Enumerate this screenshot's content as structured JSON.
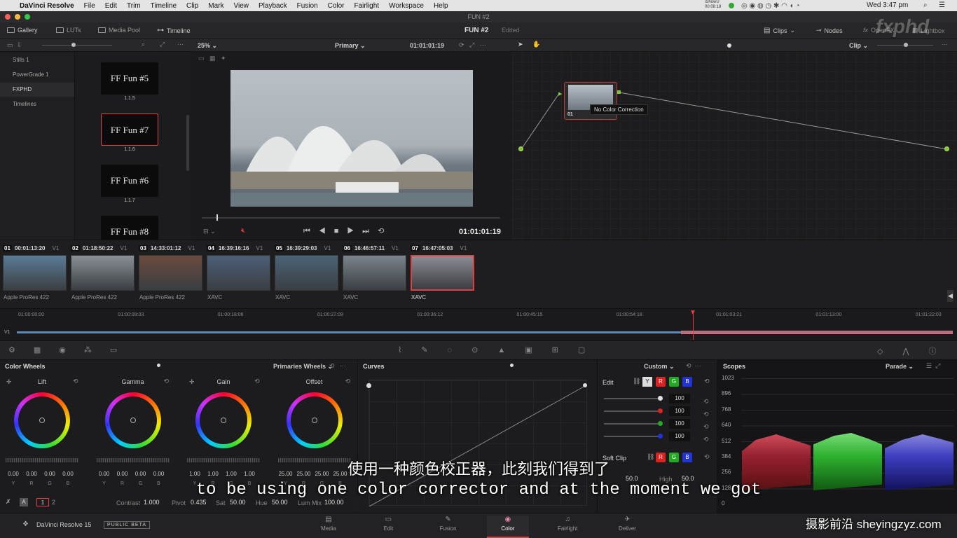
{
  "menubar": {
    "app": "DaVinci Resolve",
    "items": [
      "File",
      "Edit",
      "Trim",
      "Timeline",
      "Clip",
      "Mark",
      "View",
      "Playback",
      "Fusion",
      "Color",
      "Fairlight",
      "Workspace",
      "Help"
    ],
    "clock": "Wed 3:47 pm",
    "ishowu": "iShowU",
    "ishowu_time": "00:08:18"
  },
  "window_title": "FUN #2",
  "topbar": {
    "gallery": "Gallery",
    "luts": "LUTs",
    "media_pool": "Media Pool",
    "timeline": "Timeline",
    "project": "FUN #2",
    "status": "Edited",
    "clips": "Clips",
    "nodes": "Nodes",
    "openfx": "OpenFX",
    "lightbox": "Lightbox",
    "watermark": "fxphd"
  },
  "viewer": {
    "zoom": "25%",
    "grade_mode": "Primary",
    "timecode_top": "01:01:01:19",
    "timecode": "01:01:01:19",
    "node_mode": "Clip"
  },
  "gallery": {
    "items": [
      "Stills 1",
      "PowerGrade 1",
      "FXPHD",
      "Timelines"
    ],
    "stills": [
      {
        "label": "FF Fun #5",
        "num": "1.1.5"
      },
      {
        "label": "FF Fun #7",
        "num": "1.1.6"
      },
      {
        "label": "FF Fun #6",
        "num": "1.1.7"
      },
      {
        "label": "FF Fun #8",
        "num": ""
      }
    ]
  },
  "nodes": {
    "node_label": "01",
    "tooltip": "No Color Correction"
  },
  "clips": [
    {
      "num": "01",
      "tc": "00:01:13:20",
      "track": "V1",
      "codec": "Apple ProRes 422",
      "color": "#5b7b96"
    },
    {
      "num": "02",
      "tc": "01:18:50:22",
      "track": "V1",
      "codec": "Apple ProRes 422",
      "color": "#8a9096"
    },
    {
      "num": "03",
      "tc": "14:33:01:12",
      "track": "V1",
      "codec": "Apple ProRes 422",
      "color": "#6b4a3e"
    },
    {
      "num": "04",
      "tc": "16:39:16:16",
      "track": "V1",
      "codec": "XAVC",
      "color": "#4d5f78"
    },
    {
      "num": "05",
      "tc": "16:39:29:03",
      "track": "V1",
      "codec": "XAVC",
      "color": "#4b6478"
    },
    {
      "num": "06",
      "tc": "16:46:57:11",
      "track": "V1",
      "codec": "XAVC",
      "color": "#7b848c"
    },
    {
      "num": "07",
      "tc": "16:47:05:03",
      "track": "V1",
      "codec": "XAVC",
      "color": "#8a8e94"
    }
  ],
  "timeline_ticks": [
    "01:00:00:00",
    "01:00:09:03",
    "01:00:18:06",
    "01:00:27:09",
    "01:00:36:12",
    "01:00:45:15",
    "01:00:54:18",
    "01:01:03:21",
    "01:01:13:00",
    "01:01:22:03"
  ],
  "track_label": "V1",
  "color_wheels": {
    "title": "Color Wheels",
    "mode": "Primaries Wheels",
    "wheels": [
      {
        "name": "Lift",
        "values": [
          "0.00",
          "0.00",
          "0.00",
          "0.00"
        ]
      },
      {
        "name": "Gamma",
        "values": [
          "0.00",
          "0.00",
          "0.00",
          "0.00"
        ]
      },
      {
        "name": "Gain",
        "values": [
          "1.00",
          "1.00",
          "1.00",
          "1.00"
        ]
      },
      {
        "name": "Offset",
        "values": [
          "25.00",
          "25.00",
          "25.00",
          "25.00"
        ]
      }
    ],
    "channel_labels": [
      "Y",
      "R",
      "G",
      "B"
    ],
    "page1": "1",
    "page2": "2",
    "contrast_label": "Contrast",
    "contrast": "1.000",
    "pivot_label": "Pivot",
    "pivot": "0.435",
    "sat_label": "Sat",
    "sat": "50.00",
    "hue_label": "Hue",
    "hue": "50.00",
    "lummix_label": "Lum Mix",
    "lummix": "100.00"
  },
  "curves": {
    "title": "Curves",
    "mode": "Custom",
    "edit_label": "Edit",
    "channels": [
      "Y",
      "R",
      "G",
      "B"
    ],
    "values": [
      "100",
      "100",
      "100",
      "100"
    ],
    "soft_clip": "Soft Clip",
    "low_val": "50.0",
    "high_label": "High",
    "high_val": "50.0"
  },
  "scopes": {
    "title": "Scopes",
    "mode": "Parade",
    "axis": [
      "1023",
      "896",
      "768",
      "640",
      "512",
      "384",
      "256",
      "128",
      "0"
    ]
  },
  "bottom": {
    "app": "DaVinci Resolve 15",
    "badge": "PUBLIC BETA",
    "pages": [
      "Media",
      "Edit",
      "Fusion",
      "Color",
      "Fairlight",
      "Deliver"
    ],
    "active": "Color"
  },
  "subtitles": {
    "cn": "使用一种颜色校正器，此刻我们得到了",
    "en": "to be using one color corrector and at the moment we got",
    "site": "摄影前沿 sheyingzyz.com"
  }
}
